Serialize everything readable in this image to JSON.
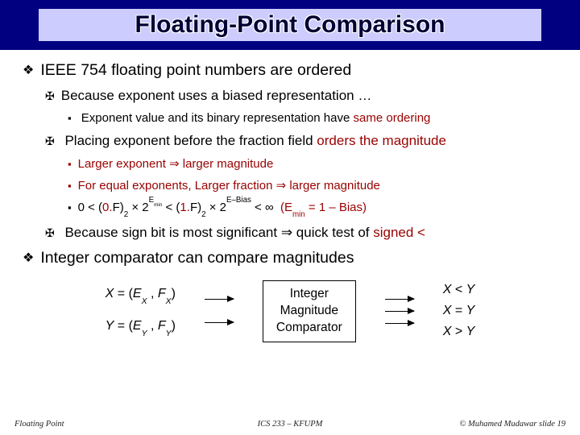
{
  "title": "Floating-Point Comparison",
  "p1": "IEEE 754 floating point numbers are ordered",
  "p1a": "Because exponent uses a biased representation …",
  "p1a1_a": "Exponent value and its binary representation have ",
  "p1a1_b": "same ordering",
  "p1b_a": "Placing exponent before the fraction field ",
  "p1b_b": "orders the magnitude",
  "p1b1": "Larger exponent ⇒ larger magnitude",
  "p1b2": "For equal exponents, Larger fraction ⇒ larger magnitude",
  "p1b3_html": "0 &lt; (<span class='red'>0.</span>F)<sub>2</sub> × 2<sup>E<sub>min</sub></sup> &lt; (<span class='red'>1.</span>F)<sub>2</sub> × 2<sup>E–Bias</sup> &lt; ∞ &nbsp;<span class='red'>(E<sub>min</sub> = 1 – Bias)</span>",
  "p1c_a": "Because sign bit is most significant ⇒ quick test of ",
  "p1c_b": "signed <",
  "p2": "Integer comparator can compare magnitudes",
  "diag": {
    "x_html": "<span class='ital'>X</span> = (<span class='ital'>E<sub>X</sub></span> , <span class='ital'>F<sub>X</sub></span>)",
    "y_html": "<span class='ital'>Y</span> = (<span class='ital'>E<sub>Y</sub></span> , <span class='ital'>F<sub>Y</sub></span>)",
    "box_html": "Integer<br>Magnitude<br>Comparator",
    "r1_html": "<span class='ital'>X</span> &lt; <span class='ital'>Y</span>",
    "r2_html": "<span class='ital'>X</span> = <span class='ital'>Y</span>",
    "r3_html": "<span class='ital'>X</span> &gt; <span class='ital'>Y</span>"
  },
  "footer": {
    "left": "Floating Point",
    "mid": "ICS 233 – KFUPM",
    "right": "© Muhamed Mudawar  slide 19"
  }
}
